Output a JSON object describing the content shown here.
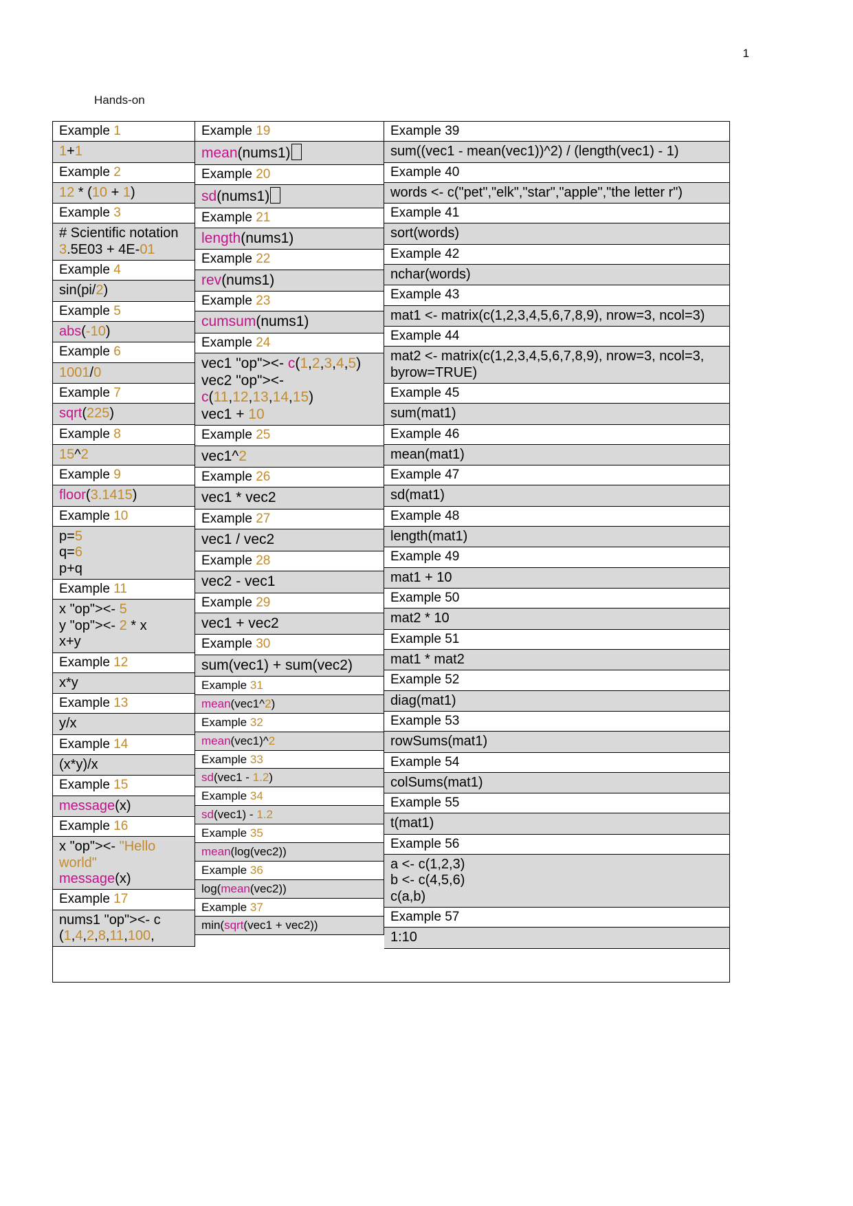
{
  "page": {
    "number": "1",
    "section_title": "Hands-on"
  },
  "columns": [
    {
      "id": "column-1",
      "rows": [
        {
          "type": "label",
          "text": "Example 1"
        },
        {
          "type": "code",
          "text": "1+1"
        },
        {
          "type": "label",
          "text": "Example 2"
        },
        {
          "type": "code",
          "text": "12 * (10 + 1)"
        },
        {
          "type": "label",
          "text": "Example 3"
        },
        {
          "type": "code",
          "text": "# Scientific notation\n3.5E03 + 4E-01"
        },
        {
          "type": "label",
          "text": "Example 4"
        },
        {
          "type": "code",
          "text": "sin(pi/2)"
        },
        {
          "type": "label",
          "text": "Example 5"
        },
        {
          "type": "code",
          "text": "abs(-10)"
        },
        {
          "type": "label",
          "text": "Example 6"
        },
        {
          "type": "code",
          "text": "1001/0"
        },
        {
          "type": "label",
          "text": "Example 7"
        },
        {
          "type": "code",
          "text": "sqrt(225)"
        },
        {
          "type": "label",
          "text": "Example 8"
        },
        {
          "type": "code",
          "text": "15^2"
        },
        {
          "type": "label",
          "text": "Example 9"
        },
        {
          "type": "code",
          "text": "floor(3.1415)"
        },
        {
          "type": "label",
          "text": "Example 10"
        },
        {
          "type": "code",
          "text": "p=5\nq=6\np+q"
        },
        {
          "type": "label",
          "text": "Example 11"
        },
        {
          "type": "code",
          "text": "x <- 5\ny <- 2 * x\nx+y"
        },
        {
          "type": "label",
          "text": "Example 12"
        },
        {
          "type": "code",
          "text": "x*y"
        },
        {
          "type": "label",
          "text": "Example 13"
        },
        {
          "type": "code",
          "text": "y/x"
        },
        {
          "type": "label",
          "text": "Example 14"
        },
        {
          "type": "code",
          "text": "(x*y)/x"
        },
        {
          "type": "label",
          "text": "Example 15"
        },
        {
          "type": "code",
          "text": "message(x)"
        },
        {
          "type": "label",
          "text": "Example 16"
        },
        {
          "type": "code",
          "text": "x <- \"Hello world\"\nmessage(x)"
        },
        {
          "type": "label",
          "text": "Example 17"
        },
        {
          "type": "code",
          "text": "nums1 <- c (1,4,2,8,11,100,"
        }
      ]
    },
    {
      "id": "column-2",
      "rows": [
        {
          "type": "label",
          "text": "Example 19"
        },
        {
          "type": "code",
          "text": "mean(nums1)"
        },
        {
          "type": "label",
          "text": "Example 20"
        },
        {
          "type": "code",
          "text": "sd(nums1)"
        },
        {
          "type": "label",
          "text": "Example 21"
        },
        {
          "type": "code",
          "text": "length(nums1)"
        },
        {
          "type": "label",
          "text": "Example 22"
        },
        {
          "type": "code",
          "text": "rev(nums1)"
        },
        {
          "type": "label",
          "text": "Example 23"
        },
        {
          "type": "code",
          "text": "cumsum(nums1)"
        },
        {
          "type": "label",
          "text": "Example 24"
        },
        {
          "type": "code",
          "text": "vec1 <- c(1,2,3,4,5)\nvec2 <- c(11,12,13,14,15)\nvec1 + 10"
        },
        {
          "type": "label",
          "text": "Example 25"
        },
        {
          "type": "code",
          "text": "vec1^2"
        },
        {
          "type": "label",
          "text": "Example 26"
        },
        {
          "type": "code",
          "text": "vec1 * vec2"
        },
        {
          "type": "label",
          "text": "Example 27"
        },
        {
          "type": "code",
          "text": "vec1 / vec2"
        },
        {
          "type": "label",
          "text": "Example 28"
        },
        {
          "type": "code",
          "text": "vec2 - vec1"
        },
        {
          "type": "label",
          "text": "Example 29"
        },
        {
          "type": "code",
          "text": "vec1 + vec2"
        },
        {
          "type": "label",
          "text": "Example 30"
        },
        {
          "type": "code",
          "text": "sum(vec1) + sum(vec2)"
        },
        {
          "type": "label",
          "text": "Example 31"
        },
        {
          "type": "code",
          "text": "mean(vec1^2)"
        },
        {
          "type": "label",
          "text": "Example 32"
        },
        {
          "type": "code",
          "text": "mean(vec1)^2"
        },
        {
          "type": "label",
          "text": "Example 33"
        },
        {
          "type": "code",
          "text": "sd(vec1 - 1.2)"
        },
        {
          "type": "label",
          "text": "Example 34"
        },
        {
          "type": "code",
          "text": "sd(vec1) - 1.2"
        },
        {
          "type": "label",
          "text": "Example 35"
        },
        {
          "type": "code",
          "text": "mean(log(vec2))"
        },
        {
          "type": "label",
          "text": "Example 36"
        },
        {
          "type": "code",
          "text": "log(mean(vec2))"
        },
        {
          "type": "label",
          "text": "Example 37"
        },
        {
          "type": "code",
          "text": "min(sqrt(vec1 + vec2))"
        }
      ]
    },
    {
      "id": "column-3",
      "rows": [
        {
          "type": "label",
          "text": "Example 39"
        },
        {
          "type": "code",
          "text": "sum((vec1 - mean(vec1))^2) / (length(vec1) - 1)"
        },
        {
          "type": "label",
          "text": "Example 40"
        },
        {
          "type": "code",
          "text": "words <- c(\"pet\",\"elk\",\"star\",\"apple\",\"the letter r\")"
        },
        {
          "type": "label",
          "text": "Example 41"
        },
        {
          "type": "code",
          "text": "sort(words)"
        },
        {
          "type": "label",
          "text": "Example 42"
        },
        {
          "type": "code",
          "text": "nchar(words)"
        },
        {
          "type": "label",
          "text": "Example 43"
        },
        {
          "type": "code",
          "text": "mat1 <- matrix(c(1,2,3,4,5,6,7,8,9), nrow=3, ncol=3)"
        },
        {
          "type": "label",
          "text": "Example 44"
        },
        {
          "type": "code",
          "text": "mat2 <- matrix(c(1,2,3,4,5,6,7,8,9), nrow=3, ncol=3, byrow=TRUE)"
        },
        {
          "type": "label",
          "text": "Example 45"
        },
        {
          "type": "code",
          "text": "sum(mat1)"
        },
        {
          "type": "label",
          "text": "Example 46"
        },
        {
          "type": "code",
          "text": "mean(mat1)"
        },
        {
          "type": "label",
          "text": "Example 47"
        },
        {
          "type": "code",
          "text": "sd(mat1)"
        },
        {
          "type": "label",
          "text": "Example 48"
        },
        {
          "type": "code",
          "text": "length(mat1)"
        },
        {
          "type": "label",
          "text": "Example 49"
        },
        {
          "type": "code",
          "text": "mat1 + 10"
        },
        {
          "type": "label",
          "text": "Example 50"
        },
        {
          "type": "code",
          "text": "mat2 * 10"
        },
        {
          "type": "label",
          "text": "Example 51"
        },
        {
          "type": "code",
          "text": "mat1 * mat2"
        },
        {
          "type": "label",
          "text": "Example 52"
        },
        {
          "type": "code",
          "text": "diag(mat1)"
        },
        {
          "type": "label",
          "text": "Example 53"
        },
        {
          "type": "code",
          "text": "rowSums(mat1)"
        },
        {
          "type": "label",
          "text": "Example 54"
        },
        {
          "type": "code",
          "text": "colSums(mat1)"
        },
        {
          "type": "label",
          "text": "Example 55"
        },
        {
          "type": "code",
          "text": "t(mat1)"
        },
        {
          "type": "label",
          "text": "Example 56"
        },
        {
          "type": "code",
          "text": "a <- c(1,2,3)\nb <- c(4,5,6)\nc(a,b)"
        },
        {
          "type": "label",
          "text": "Example 57"
        },
        {
          "type": "code",
          "text": "1:10"
        }
      ]
    }
  ],
  "colors": {
    "function_name": "#c2138b",
    "number_literal": "#c28b2b",
    "string_literal": "#c28b2b",
    "assign_operator": "#a81a60",
    "row_shade": "#d9d9d9",
    "border": "#000000"
  }
}
